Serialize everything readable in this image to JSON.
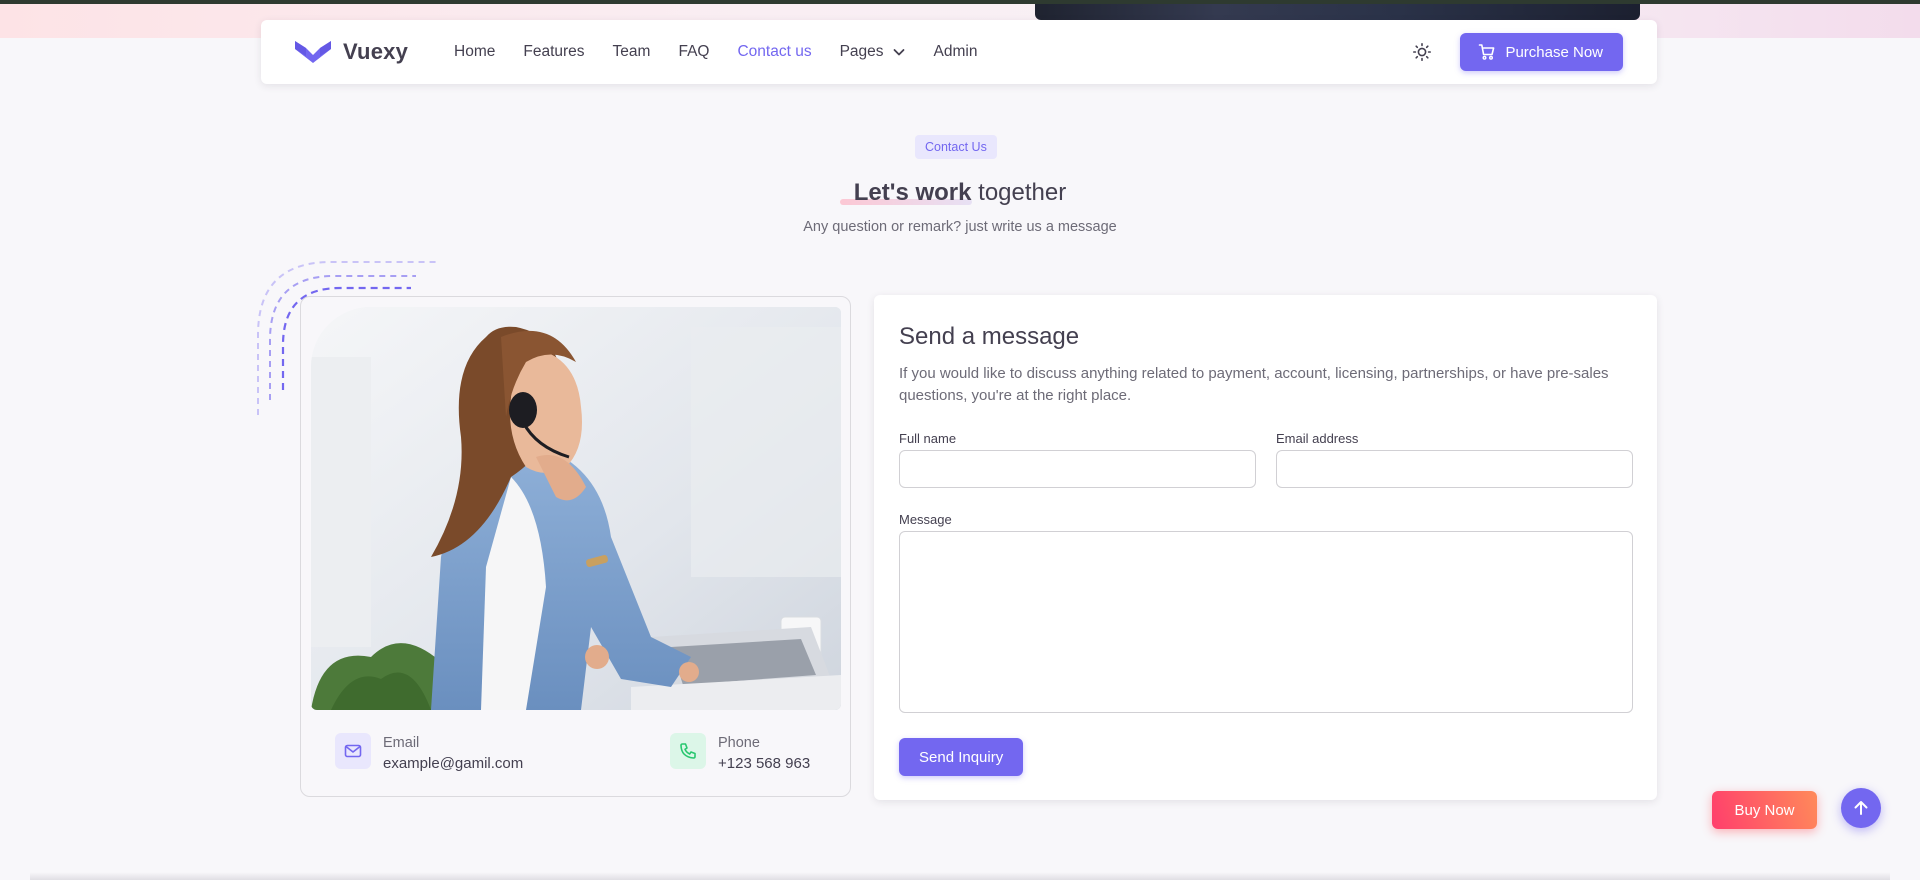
{
  "brand": {
    "name": "Vuexy",
    "color": "#7367f0"
  },
  "nav": {
    "links": [
      {
        "label": "Home"
      },
      {
        "label": "Features"
      },
      {
        "label": "Team"
      },
      {
        "label": "FAQ"
      },
      {
        "label": "Contact us",
        "active": true
      },
      {
        "label": "Pages",
        "dropdown": true
      },
      {
        "label": "Admin"
      }
    ],
    "theme_icon": "sun-icon",
    "purchase_label": "Purchase Now",
    "purchase_icon": "shopping-cart-icon"
  },
  "section": {
    "badge": "Contact Us",
    "title_bold": "Let's work",
    "title_rest": " together",
    "subtitle": "Any question or remark? just write us a message"
  },
  "contact_info": {
    "email": {
      "label": "Email",
      "value": "example@gamil.com",
      "icon": "mail-icon"
    },
    "phone": {
      "label": "Phone",
      "value": "+123 568 963",
      "icon": "phone-icon"
    }
  },
  "form": {
    "title": "Send a message",
    "description": "If you would like to discuss anything related to payment, account, licensing, partnerships, or have pre-sales questions, you're at the right place.",
    "fullname_label": "Full name",
    "fullname_value": "",
    "email_label": "Email address",
    "email_value": "",
    "message_label": "Message",
    "message_value": "",
    "submit_label": "Send Inquiry"
  },
  "floating": {
    "buy_now_label": "Buy Now",
    "scroll_top_icon": "arrow-up-icon"
  }
}
